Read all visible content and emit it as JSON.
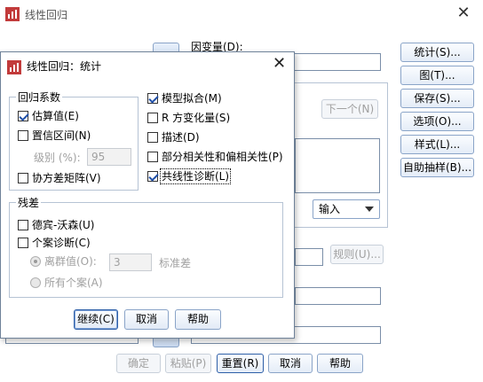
{
  "parent": {
    "title": "线性回归",
    "dependent_label": "因变量(D):",
    "next_button": "下一个(N)",
    "right_buttons": [
      "统计(S)...",
      "图(T)...",
      "保存(S)...",
      "选项(O)...",
      "样式(L)...",
      "自助抽样(B)..."
    ],
    "method_value": "输入",
    "rule_button": "规则(U)...",
    "bottom_buttons": {
      "ok": "确定",
      "paste": "粘贴(P)",
      "reset": "重置(R)",
      "cancel": "取消",
      "help": "帮助"
    }
  },
  "dialog": {
    "title": "线性回归：统计",
    "regression_coefficients": {
      "title": "回归系数",
      "estimates": {
        "label": "估算值(E)",
        "checked": true
      },
      "confidence_intervals": {
        "label": "置信区间(N)",
        "checked": false
      },
      "level_label": "级别 (%):",
      "level_value": "95",
      "covariance_matrix": {
        "label": "协方差矩阵(V)",
        "checked": false
      }
    },
    "right_options": [
      {
        "label": "模型拟合(M)",
        "checked": true
      },
      {
        "label": "R 方变化量(S)",
        "checked": false
      },
      {
        "label": "描述(D)",
        "checked": false
      },
      {
        "label": "部分相关性和偏相关性(P)",
        "checked": false
      },
      {
        "label": "共线性诊断(L)",
        "checked": true
      }
    ],
    "residuals": {
      "title": "残差",
      "durbin_watson": {
        "label": "德宾-沃森(U)",
        "checked": false
      },
      "casewise": {
        "label": "个案诊断(C)",
        "checked": false
      },
      "outliers_label": "离群值(O):",
      "outliers_value": "3",
      "outliers_unit": "标准差",
      "all_cases_label": "所有个案(A)"
    },
    "buttons": {
      "continue": "继续(C)",
      "cancel": "取消",
      "help": "帮助"
    }
  },
  "colors": {
    "accent_border": "#8aa4c8",
    "check_mark": "#1f4fa8",
    "disabled_text": "#a0a0a0"
  }
}
